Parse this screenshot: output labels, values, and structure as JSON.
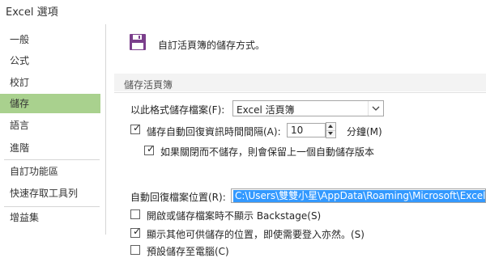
{
  "window": {
    "title": "Excel 選項"
  },
  "sidebar": {
    "items": [
      {
        "label": "一般"
      },
      {
        "label": "公式"
      },
      {
        "label": "校訂"
      },
      {
        "label": "儲存"
      },
      {
        "label": "語言"
      },
      {
        "label": "進階"
      },
      {
        "label": "自訂功能區"
      },
      {
        "label": "快速存取工具列"
      },
      {
        "label": "增益集"
      }
    ],
    "selected": "儲存",
    "accent_color": "#a9d18e"
  },
  "header": {
    "icon": "save-icon",
    "text": "自訂活頁簿的儲存方式。",
    "icon_color": "#7b3f8c"
  },
  "section": {
    "title": "儲存活頁簿"
  },
  "options": {
    "format_label": "以此格式儲存檔案(F):",
    "format_value": "Excel 活頁簿",
    "autorecover_label": "儲存自動回復資訊時間間隔(A):",
    "autorecover_checked": true,
    "interval_value": "10",
    "minutes_label": "分鐘(M)",
    "keep_last_label": "如果關閉而不儲存，則會保留上一個自動儲存版本",
    "keep_last_checked": true,
    "location_label": "自動回復檔案位置(R):",
    "location_value": "C:\\Users\\雙雙小星\\AppData\\Roaming\\Microsoft\\Excel\\",
    "backstage_label": "開啟或儲存檔案時不顯示 Backstage(S)",
    "backstage_checked": false,
    "show_additional_label": "顯示其他可供儲存的位置，即使需要登入亦然。(S)",
    "show_additional_checked": true,
    "save_to_computer_label": "預設儲存至電腦(C)",
    "save_to_computer_checked": false
  }
}
